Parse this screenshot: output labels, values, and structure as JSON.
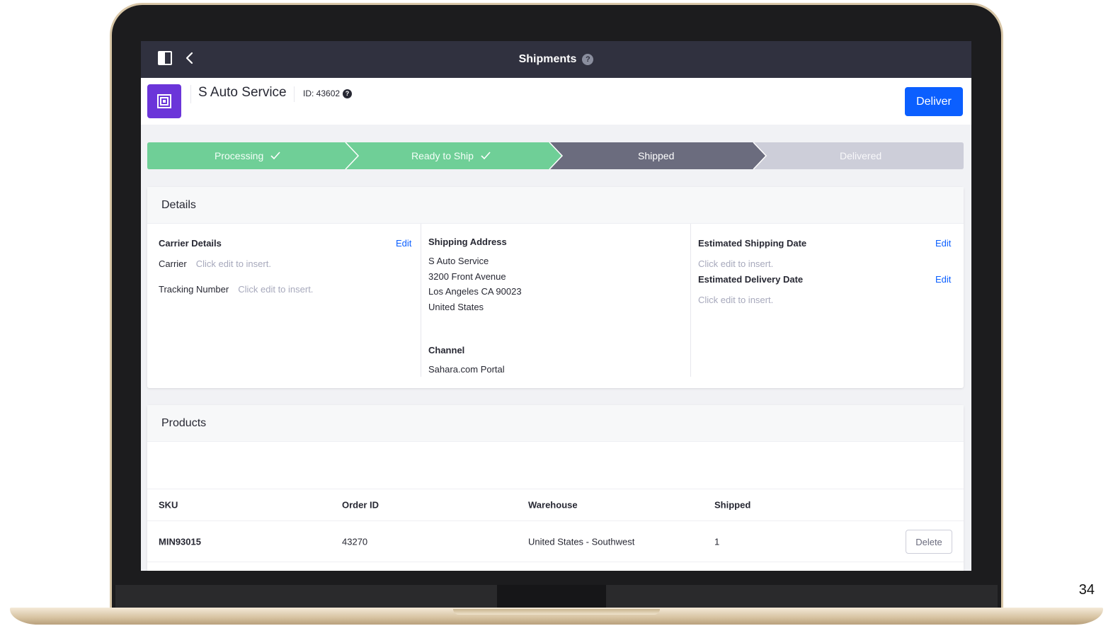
{
  "topbar": {
    "title": "Shipments"
  },
  "header": {
    "account_name": "S Auto Service",
    "id_label": "ID: 43602",
    "deliver_label": "Deliver"
  },
  "stepper": {
    "steps": [
      {
        "label": "Processing",
        "state": "complete"
      },
      {
        "label": "Ready to Ship",
        "state": "complete"
      },
      {
        "label": "Shipped",
        "state": "current"
      },
      {
        "label": "Delivered",
        "state": "pending"
      }
    ],
    "colors": {
      "complete": "#6fcf97",
      "current": "#6b6c7e",
      "pending": "#cdced9"
    }
  },
  "details": {
    "title": "Details",
    "carrier_details": {
      "title": "Carrier Details",
      "edit_label": "Edit",
      "carrier_label": "Carrier",
      "carrier_placeholder": "Click edit to insert.",
      "tracking_label": "Tracking Number",
      "tracking_placeholder": "Click edit to insert."
    },
    "shipping_address": {
      "title": "Shipping Address",
      "lines": [
        "S Auto Service",
        "3200 Front Avenue",
        "Los Angeles CA 90023",
        "United States"
      ]
    },
    "channel": {
      "title": "Channel",
      "value": "Sahara.com Portal"
    },
    "estimated_shipping": {
      "title": "Estimated Shipping Date",
      "edit_label": "Edit",
      "placeholder": "Click edit to insert."
    },
    "estimated_delivery": {
      "title": "Estimated Delivery Date",
      "edit_label": "Edit",
      "placeholder": "Click edit to insert."
    }
  },
  "products": {
    "title": "Products",
    "columns": [
      "SKU",
      "Order ID",
      "Warehouse",
      "Shipped"
    ],
    "rows": [
      {
        "sku": "MIN93015",
        "order_id": "43270",
        "warehouse": "United States - Southwest",
        "shipped": "1",
        "action": "Delete"
      }
    ]
  },
  "slide_number": "34",
  "colors": {
    "topbar": "#30313f",
    "accent": "#0b5fff",
    "logo": "#6b35d9"
  }
}
